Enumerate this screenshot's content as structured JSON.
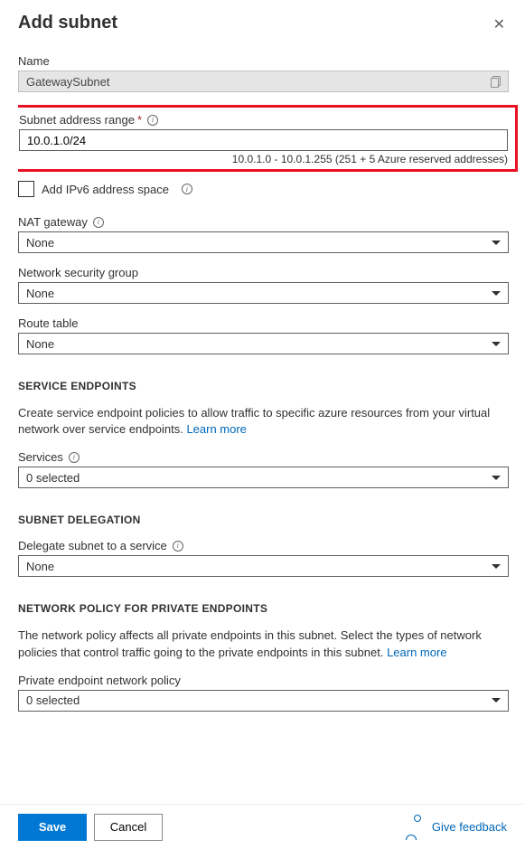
{
  "header": {
    "title": "Add subnet"
  },
  "name": {
    "label": "Name",
    "value": "GatewaySubnet"
  },
  "subnetRange": {
    "label": "Subnet address range",
    "value": "10.0.1.0/24",
    "hint": "10.0.1.0 - 10.0.1.255 (251 + 5 Azure reserved addresses)"
  },
  "ipv6": {
    "label": "Add IPv6 address space"
  },
  "natGateway": {
    "label": "NAT gateway",
    "value": "None"
  },
  "nsg": {
    "label": "Network security group",
    "value": "None"
  },
  "routeTable": {
    "label": "Route table",
    "value": "None"
  },
  "serviceEndpoints": {
    "heading": "SERVICE ENDPOINTS",
    "desc": "Create service endpoint policies to allow traffic to specific azure resources from your virtual network over service endpoints. ",
    "learn": "Learn more",
    "servicesLabel": "Services",
    "servicesValue": "0 selected"
  },
  "delegation": {
    "heading": "SUBNET DELEGATION",
    "label": "Delegate subnet to a service",
    "value": "None"
  },
  "networkPolicy": {
    "heading": "NETWORK POLICY FOR PRIVATE ENDPOINTS",
    "desc": "The network policy affects all private endpoints in this subnet. Select the types of network policies that control traffic going to the private endpoints in this subnet. ",
    "learn": "Learn more",
    "label": "Private endpoint network policy",
    "value": "0 selected"
  },
  "footer": {
    "save": "Save",
    "cancel": "Cancel",
    "feedback": "Give feedback"
  }
}
